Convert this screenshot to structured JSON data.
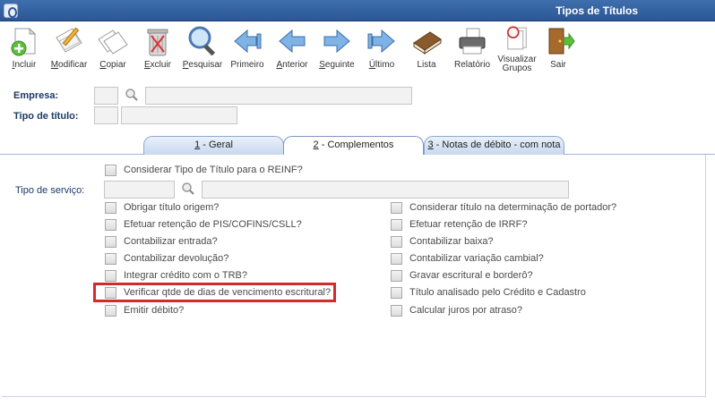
{
  "window": {
    "title": "Tipos de Títulos"
  },
  "toolbar": {
    "buttons": [
      {
        "label": "Incluir",
        "icon": "add-document-icon"
      },
      {
        "label": "Modificar",
        "icon": "edit-document-icon"
      },
      {
        "label": "Copiar",
        "icon": "copy-document-icon"
      },
      {
        "label": "Excluir",
        "icon": "trash-icon"
      },
      {
        "label": "Pesquisar",
        "icon": "magnifier-icon"
      },
      {
        "label": "Primeiro",
        "icon": "first-arrow-icon"
      },
      {
        "label": "Anterior",
        "icon": "previous-arrow-icon"
      },
      {
        "label": "Seguinte",
        "icon": "next-arrow-icon"
      },
      {
        "label": "Último",
        "icon": "last-arrow-icon"
      },
      {
        "label": "Lista",
        "icon": "book-icon"
      },
      {
        "label": "Relatório",
        "icon": "printer-icon"
      },
      {
        "label": "Visualizar\nGrupos",
        "icon": "view-groups-icon"
      },
      {
        "label": "Sair",
        "icon": "exit-door-icon"
      }
    ]
  },
  "header": {
    "empresa_label": "Empresa:",
    "tipo_titulo_label": "Tipo de título:"
  },
  "tabs": [
    {
      "num": "1",
      "label": " - Geral"
    },
    {
      "num": "2",
      "label": " - Complementos"
    },
    {
      "num": "3",
      "label": " - Notas de débito - com nota"
    }
  ],
  "complementos": {
    "reinf_label": "Considerar Tipo de Título para o REINF?",
    "tipo_servico_label": "Tipo de serviço:",
    "left_checks": [
      "Obrigar título origem?",
      "Efetuar retenção de PIS/COFINS/CSLL?",
      "Contabilizar entrada?",
      "Contabilizar devolução?",
      "Integrar crédito com o TRB?",
      "Verificar qtde de dias de vencimento escritural?",
      "Emitir débito?"
    ],
    "right_checks": [
      "Considerar título na determinação de portador?",
      "Efetuar retenção de IRRF?",
      "Contabilizar baixa?",
      "Contabilizar variação cambial?",
      "Gravar escritural e borderô?",
      "Título analisado pelo Crédito e Cadastro",
      "Calcular juros por atraso?"
    ]
  },
  "colors": {
    "titlebar": "#2b5693",
    "label_blue": "#1b3a66",
    "highlight_red": "#d42a2a"
  }
}
